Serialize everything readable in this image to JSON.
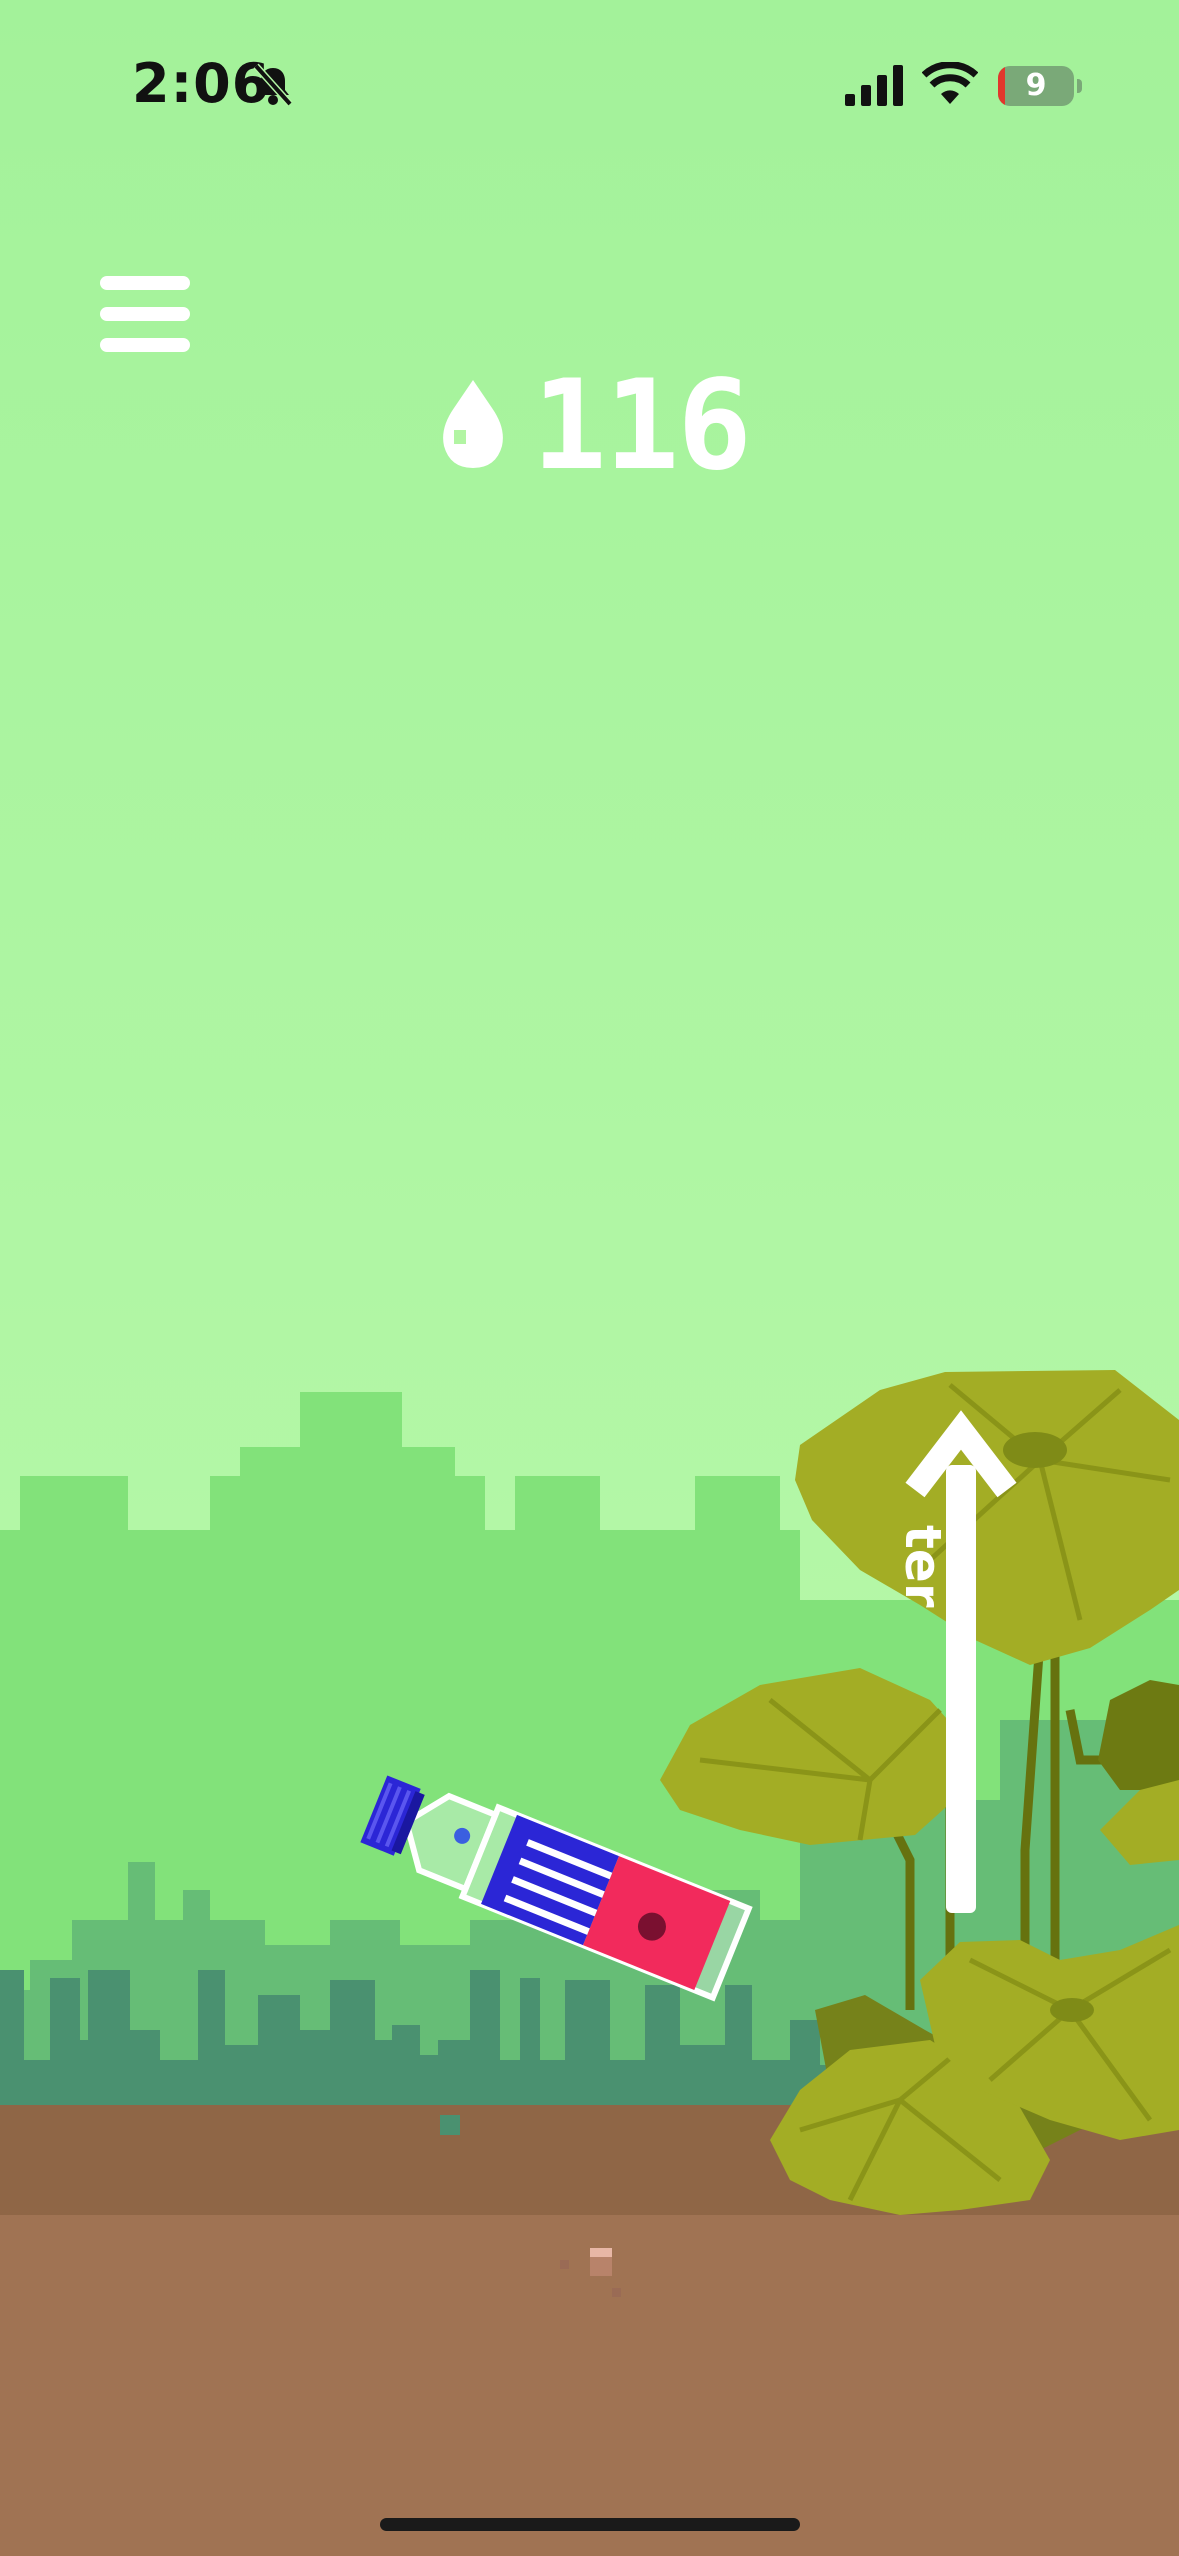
{
  "status_bar": {
    "time": "2:06",
    "bell_icon": "bell-slash-icon",
    "signal_icon": "cellular-signal-icon",
    "wifi_icon": "wifi-icon",
    "battery_level": "9",
    "battery_fraction": 0.09
  },
  "hud": {
    "menu_icon": "hamburger-menu-icon",
    "drop_icon": "water-drop-icon",
    "water_count": "116"
  },
  "gesture_hint": {
    "label": "ter",
    "arrow_icon": "swipe-up-arrow-icon"
  },
  "colors": {
    "sky": "#b2f5a3",
    "far_hills": "#82e27a",
    "near_hills": "#66bd76",
    "grass": "#4a9170",
    "topsoil": "#8f6646",
    "soil": "#a07353",
    "leaf": "#a3ad25",
    "leaf_dark": "#7f8b17",
    "bottle_blue": "#2b26d6",
    "bottle_red": "#f22a5c"
  }
}
